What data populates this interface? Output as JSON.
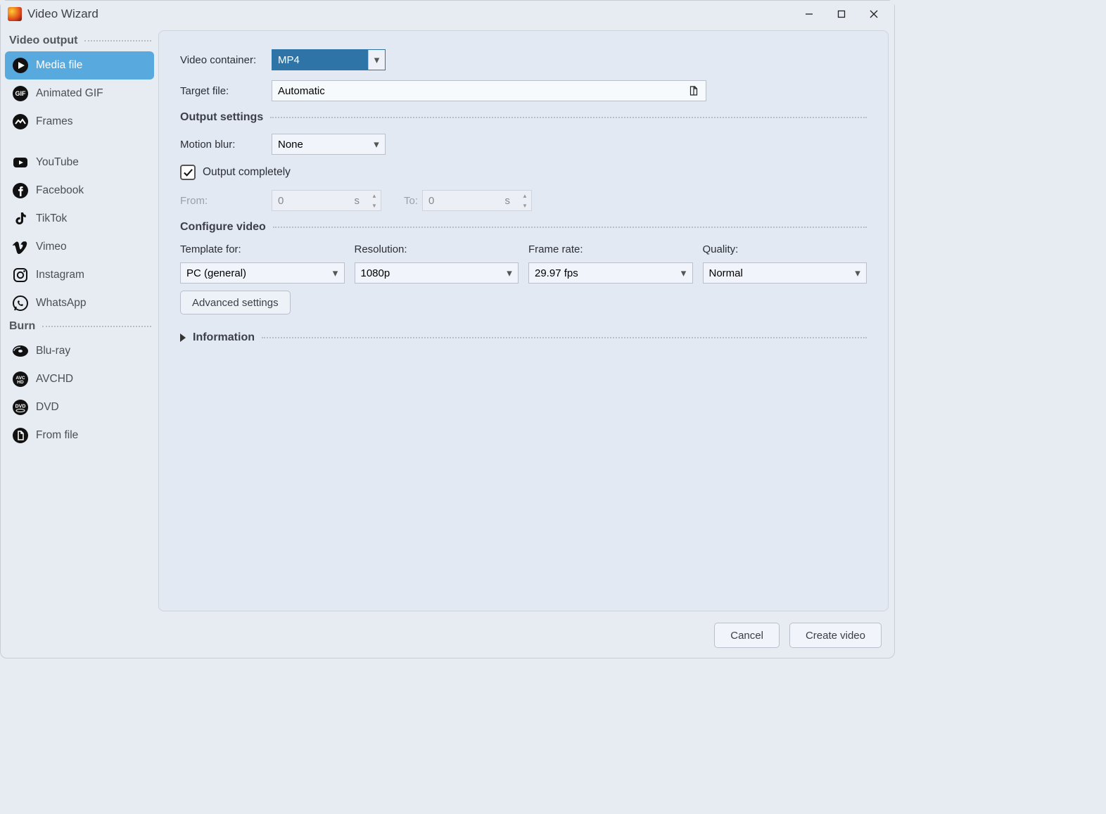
{
  "window": {
    "title": "Video Wizard"
  },
  "sidebar": {
    "groups": [
      {
        "title": "Video output",
        "items": [
          {
            "label": "Media file",
            "selected": true
          },
          {
            "label": "Animated GIF"
          },
          {
            "label": "Frames"
          }
        ]
      },
      {
        "title": "",
        "items": [
          {
            "label": "YouTube"
          },
          {
            "label": "Facebook"
          },
          {
            "label": "TikTok"
          },
          {
            "label": "Vimeo"
          },
          {
            "label": "Instagram"
          },
          {
            "label": "WhatsApp"
          }
        ]
      },
      {
        "title": "Burn",
        "items": [
          {
            "label": "Blu-ray"
          },
          {
            "label": "AVCHD"
          },
          {
            "label": "DVD"
          },
          {
            "label": "From file"
          }
        ]
      }
    ]
  },
  "form": {
    "video_container_label": "Video container:",
    "video_container_value": "MP4",
    "target_file_label": "Target file:",
    "target_file_value": "Automatic",
    "output_settings_title": "Output settings",
    "motion_blur_label": "Motion blur:",
    "motion_blur_value": "None",
    "output_completely_label": "Output completely",
    "output_completely_checked": true,
    "from_label": "From:",
    "from_value": "0",
    "from_unit": "s",
    "to_label": "To:",
    "to_value": "0",
    "to_unit": "s",
    "configure_video_title": "Configure video",
    "template_label": "Template for:",
    "template_value": "PC (general)",
    "resolution_label": "Resolution:",
    "resolution_value": "1080p",
    "framerate_label": "Frame rate:",
    "framerate_value": "29.97 fps",
    "quality_label": "Quality:",
    "quality_value": "Normal",
    "advanced_button": "Advanced settings",
    "information_title": "Information"
  },
  "footer": {
    "cancel": "Cancel",
    "create": "Create video"
  }
}
